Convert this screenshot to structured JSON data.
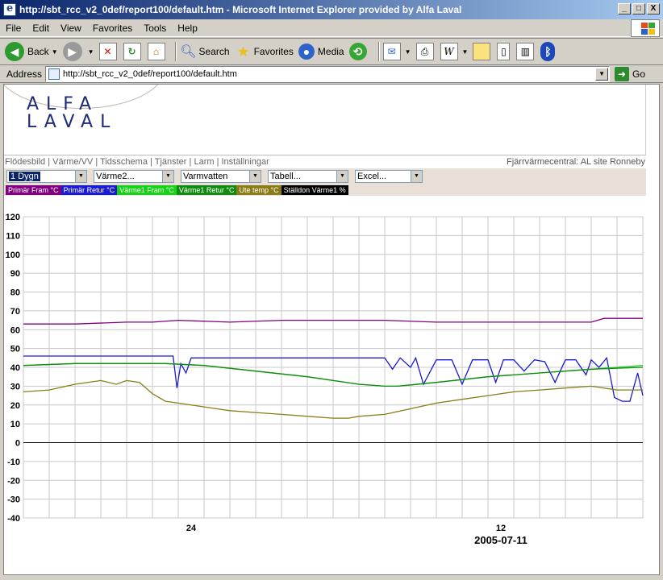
{
  "window": {
    "title": "http://sbt_rcc_v2_0def/report100/default.htm - Microsoft Internet Explorer provided by Alfa Laval",
    "minimize": "_",
    "maximize": "□",
    "close": "X"
  },
  "menu": {
    "items": [
      {
        "label": "File"
      },
      {
        "label": "Edit"
      },
      {
        "label": "View"
      },
      {
        "label": "Favorites"
      },
      {
        "label": "Tools"
      },
      {
        "label": "Help"
      }
    ]
  },
  "toolbar": {
    "back_label": "Back",
    "search_label": "Search",
    "favorites_label": "Favorites",
    "media_label": "Media",
    "icons": [
      "back-icon",
      "forward-icon",
      "stop-icon",
      "refresh-icon",
      "home-icon",
      "search-icon",
      "favorites-icon",
      "media-icon",
      "history-icon",
      "mail-icon",
      "print-icon",
      "edit-icon",
      "discuss-icon",
      "messenger-icon",
      "research-icon",
      "bluetooth-icon"
    ]
  },
  "address": {
    "label": "Address",
    "url": "http://sbt_rcc_v2_0def/report100/default.htm",
    "go_label": "Go"
  },
  "page": {
    "logo_line1": "ALFA",
    "logo_line2": "LAVAL",
    "nav_links": [
      "Flödesbild",
      "Värme/VV",
      "Tidsschema",
      "Tjänster",
      "Larm",
      "Inställningar"
    ],
    "nav_separator": " | ",
    "site_name": "Fjärrvärmecentral: AL site Ronneby",
    "selects": [
      {
        "value": "1 Dygn",
        "active": true
      },
      {
        "value": "Värme2...",
        "active": false
      },
      {
        "value": "Varmvatten",
        "active": false
      },
      {
        "value": "Tabell...",
        "active": false
      },
      {
        "value": "Excel...",
        "active": false
      }
    ],
    "legend": [
      {
        "label": "Primär Fram °C",
        "color": "#800080"
      },
      {
        "label": "Primär Retur °C",
        "color": "#1a1ad0"
      },
      {
        "label": "Värme1 Fram °C",
        "color": "#17d217"
      },
      {
        "label": "Värme1 Retur °C",
        "color": "#128a12"
      },
      {
        "label": "Ute temp °C",
        "color": "#8a7d18"
      },
      {
        "label": "Ställdon Värme1 %",
        "color": "#000000"
      }
    ]
  },
  "chart_data": {
    "type": "line",
    "ylim": [
      -40,
      120
    ],
    "yticks": [
      -40,
      -30,
      -20,
      -10,
      0,
      10,
      20,
      30,
      40,
      50,
      60,
      70,
      80,
      90,
      100,
      110,
      120
    ],
    "xlim": [
      0,
      24
    ],
    "xtick_labels": [
      {
        "at": 6.5,
        "label": "24"
      },
      {
        "at": 18.5,
        "label": "12"
      }
    ],
    "date_label": "2005-07-11",
    "grid": true,
    "series": [
      {
        "name": "Primär Fram °C",
        "color": "#800080",
        "x": [
          0,
          2,
          4,
          5,
          6,
          8,
          10,
          12,
          14,
          16,
          18,
          20,
          22,
          22.5,
          23,
          24
        ],
        "y": [
          63,
          63,
          64,
          64,
          65,
          64,
          65,
          65,
          65,
          64,
          64,
          64,
          64,
          66,
          66,
          66
        ]
      },
      {
        "name": "Primär Retur °C",
        "color": "#1a1ad0",
        "x": [
          0,
          2,
          4,
          5.8,
          5.95,
          6.1,
          6.3,
          6.5,
          8,
          10,
          12,
          14,
          14.3,
          14.6,
          15,
          15.2,
          15.5,
          16,
          16.6,
          17,
          17.4,
          18,
          18.3,
          18.6,
          19,
          19.4,
          19.8,
          20.2,
          20.6,
          21,
          21.4,
          21.8,
          22,
          22.3,
          22.6,
          22.9,
          23.2,
          23.5,
          23.8,
          24
        ],
        "y": [
          46,
          46,
          46,
          46,
          29,
          42,
          37,
          45,
          45,
          45,
          45,
          45,
          39,
          45,
          40,
          45,
          31,
          44,
          44,
          31,
          44,
          44,
          32,
          44,
          44,
          38,
          44,
          43,
          32,
          44,
          44,
          36,
          44,
          40,
          45,
          24,
          22,
          22,
          37,
          25
        ]
      },
      {
        "name": "Värme1 Fram °C",
        "color": "#17d217",
        "x": [
          0,
          2,
          4,
          5.5,
          7,
          9,
          11,
          13,
          14,
          14.5,
          16,
          18,
          20,
          22,
          24
        ],
        "y": [
          41,
          42,
          42,
          42,
          41,
          38,
          35,
          31,
          30,
          30,
          32,
          35,
          37,
          39,
          41
        ]
      },
      {
        "name": "Värme1 Retur °C",
        "color": "#128a12",
        "x": [
          0,
          2,
          4,
          5.5,
          7,
          9,
          11,
          13,
          14,
          14.5,
          16,
          18,
          20,
          22,
          24
        ],
        "y": [
          41,
          42,
          42,
          42,
          41,
          38,
          35,
          31,
          30,
          30,
          32,
          35,
          37,
          39,
          40
        ]
      },
      {
        "name": "Ute temp °C",
        "color": "#8a7d18",
        "x": [
          0,
          1,
          2,
          3,
          3.6,
          4,
          4.5,
          5,
          5.5,
          6,
          7,
          8,
          9,
          10,
          11,
          12,
          12.6,
          13,
          14,
          15,
          16,
          17,
          18,
          19,
          20,
          21,
          22,
          23,
          24
        ],
        "y": [
          27,
          28,
          31,
          33,
          31,
          33,
          32,
          26,
          22,
          21,
          19,
          17,
          16,
          15,
          14,
          13,
          13,
          14,
          15,
          18,
          21,
          23,
          25,
          27,
          28,
          29,
          30,
          28,
          28
        ]
      },
      {
        "name": "Ställdon Värme1 %",
        "color": "#000000",
        "x": [
          0,
          24
        ],
        "y": [
          0,
          0
        ]
      }
    ]
  }
}
